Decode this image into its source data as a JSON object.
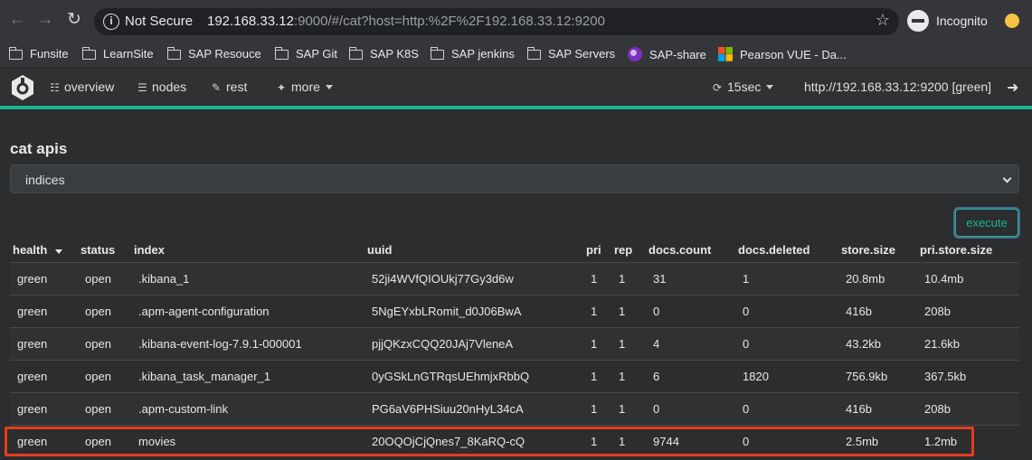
{
  "browser": {
    "security_label": "Not Secure",
    "url_host": "192.168.33.12",
    "url_rest": ":9000/#/cat?host=http:%2F%2F192.168.33.12:9200",
    "profile_label": "Incognito"
  },
  "bookmarks": [
    "Funsite",
    "LearnSite",
    "SAP Resouce",
    "SAP Git",
    "SAP K8S",
    "SAP jenkins",
    "SAP Servers",
    "SAP-share",
    "Pearson VUE - Da..."
  ],
  "app": {
    "nav": [
      "overview",
      "nodes",
      "rest",
      "more"
    ],
    "refresh_interval": "15sec",
    "cluster_url": "http://192.168.33.12:9200 [green]",
    "accent_color": "#1ab394"
  },
  "cat": {
    "title": "cat apis",
    "selected_api": "indices",
    "execute_label": "execute"
  },
  "table": {
    "headers": [
      "health",
      "status",
      "index",
      "uuid",
      "pri",
      "rep",
      "docs.count",
      "docs.deleted",
      "store.size",
      "pri.store.size"
    ],
    "rows": [
      [
        "green",
        "open",
        ".kibana_1",
        "52ji4WVfQIOUkj77Gy3d6w",
        "1",
        "1",
        "31",
        "1",
        "20.8mb",
        "10.4mb"
      ],
      [
        "green",
        "open",
        ".apm-agent-configuration",
        "5NgEYxbLRomit_d0J06BwA",
        "1",
        "1",
        "0",
        "0",
        "416b",
        "208b"
      ],
      [
        "green",
        "open",
        ".kibana-event-log-7.9.1-000001",
        "pjjQKzxCQQ20JAj7VleneA",
        "1",
        "1",
        "4",
        "0",
        "43.2kb",
        "21.6kb"
      ],
      [
        "green",
        "open",
        ".kibana_task_manager_1",
        "0yGSkLnGTRqsUEhmjxRbbQ",
        "1",
        "1",
        "6",
        "1820",
        "756.9kb",
        "367.5kb"
      ],
      [
        "green",
        "open",
        ".apm-custom-link",
        "PG6aV6PHSiuu20nHyL34cA",
        "1",
        "1",
        "0",
        "0",
        "416b",
        "208b"
      ],
      [
        "green",
        "open",
        "movies",
        "20OQOjCjQnes7_8KaRQ-cQ",
        "1",
        "1",
        "9744",
        "0",
        "2.5mb",
        "1.2mb"
      ]
    ],
    "highlighted_row": 5,
    "highlight_color": "#e63c1e"
  }
}
